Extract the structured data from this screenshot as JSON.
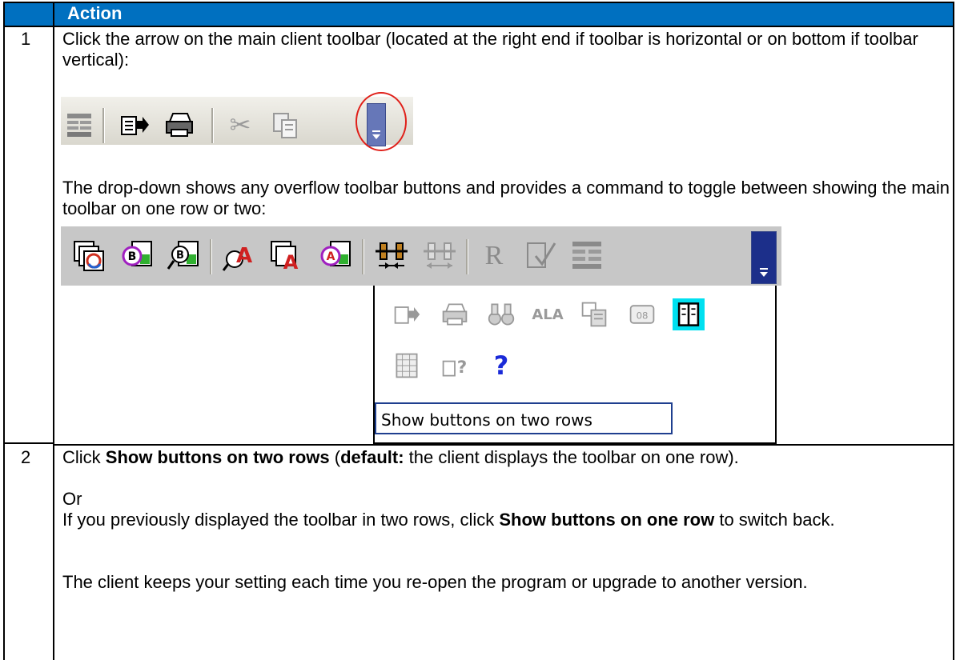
{
  "table": {
    "header": {
      "number": "",
      "action": "Action"
    },
    "rows": [
      {
        "number": "1",
        "intro": "Click the arrow on the main client toolbar (located at the right end if toolbar is horizontal or on bottom if toolbar vertical):",
        "dropdown_text": "The drop-down shows any overflow toolbar buttons and provides a command to toggle between showing the main toolbar on one row or two:"
      },
      {
        "number": "2",
        "p1_pre": "Click ",
        "p1_bold1": "Show buttons on two rows",
        "p1_mid": " (",
        "p1_bold2": "default:",
        "p1_post": " the client displays the toolbar on one row).",
        "or": "Or",
        "p2_pre": "If you previously displayed the toolbar in two rows, click ",
        "p2_bold": "Show buttons on one row",
        "p2_post": " to switch back.",
        "p3": "The client keeps your setting each time you re-open the program or upgrade to another version."
      }
    ]
  },
  "screenshot1": {
    "icons": [
      "table-icon",
      "export-icon",
      "print-icon",
      "cut-icon",
      "copy-icon"
    ],
    "highlight_color": "#e0201a",
    "chevron_color": "#6677b8"
  },
  "screenshot2": {
    "toolbar_icons": [
      "stack-layers-icon",
      "bind-icon",
      "search-bind-icon",
      "font-a-icon",
      "stack-a-icon",
      "bind-a-icon",
      "connector-icon",
      "connector-grey-icon",
      "r-icon",
      "check-edit-icon",
      "table-icon"
    ],
    "overflow_row1": [
      "export-icon",
      "print-icon",
      "binoculars-icon",
      "ala-icon",
      "calendar-icon",
      "id-card-icon",
      "book-icon"
    ],
    "overflow_row2": [
      "grid-icon",
      "help-doc-icon",
      "question-icon"
    ],
    "menu_command": "Show buttons on two rows",
    "bar_color": "#c7c7c7",
    "menu_border_color": "#1f3f8f"
  }
}
